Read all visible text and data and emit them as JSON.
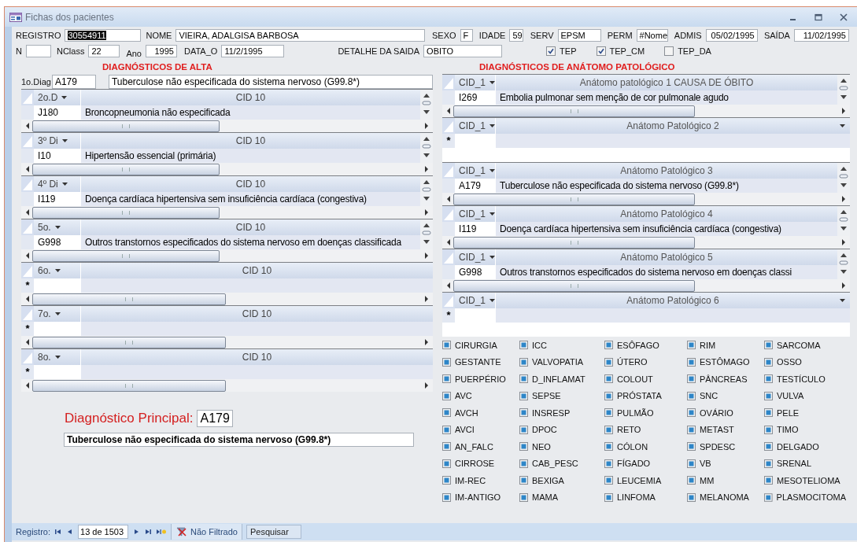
{
  "window": {
    "title": "Fichas dos pacientes"
  },
  "fields_row_1": [
    {
      "label": "REGISTRO",
      "value": "30554911",
      "selected": true
    },
    {
      "label": "NOME",
      "value": "VIEIRA, ADALGISA BARBOSA",
      "selected": false
    },
    {
      "label": "SEXO",
      "value": "F",
      "selected": false
    },
    {
      "label": "IDADE",
      "value": "59",
      "selected": false
    },
    {
      "label": "SERV",
      "value": "EPSM",
      "selected": false
    },
    {
      "label": "PERM",
      "value": "#Nome",
      "selected": false
    },
    {
      "label": "ADMIS",
      "value": "05/02/1995",
      "selected": false
    },
    {
      "label": "SAÍDA",
      "value": "11/02/1995",
      "selected": false
    }
  ],
  "fields_row_2": [
    {
      "label": "N"
    },
    {
      "label": "NClass",
      "value": "22"
    },
    {
      "label": "Ano",
      "value": "1995"
    },
    {
      "label": "DATA_O",
      "value": "11/2/1995"
    },
    {
      "label": "DETALHE DA SAIDA",
      "value": "OBITO"
    }
  ],
  "checkboxes": [
    {
      "label": "TEP",
      "checked": true
    },
    {
      "label": "TEP_CM",
      "checked": true
    },
    {
      "label": "TEP_DA",
      "checked": false
    }
  ],
  "diagnosticos_alta": {
    "title": "DIAGNÓSTICOS DE ALTA",
    "first": {
      "label": "1o.Diag",
      "code": "A179",
      "description": "Tuberculose não especificada do sistema nervoso (G99.8*)"
    },
    "subforms": [
      {
        "column_1": "2o.D",
        "column_2": "CID 10",
        "rows": [
          {
            "code": "J180",
            "description": "Broncopneumonia não especificada"
          }
        ]
      },
      {
        "column_1": "3º Di",
        "column_2": "CID 10",
        "rows": [
          {
            "code": "I10",
            "description": "Hipertensão essencial (primária)"
          }
        ]
      },
      {
        "column_1": "4º Di",
        "column_2": "CID 10",
        "rows": [
          {
            "code": "I119",
            "description": "Doença cardíaca hipertensiva sem insuficiência cardíaca (congestiva)"
          }
        ]
      },
      {
        "column_1": "5o.",
        "column_2": "CID 10",
        "rows": [
          {
            "code": "G998",
            "description": "Outros transtornos especificados do sistema nervoso em doenças classificada"
          }
        ]
      },
      {
        "column_1": "6o.",
        "column_2": "CID 10",
        "new_row": "*"
      },
      {
        "column_1": "7o.",
        "column_2": "CID 10",
        "new_row": "*"
      },
      {
        "column_1": "8o.",
        "column_2": "CID 10",
        "new_row": "*"
      }
    ],
    "principal": {
      "label": "Diagnóstico Principal:",
      "code": "A179",
      "description": "Tuberculose não especificada do sistema nervoso (G99.8*)"
    }
  },
  "anatomo_patologico": {
    "title": "DIAGNÓSTICOS DE ANÁTOMO PATOLÓGICO",
    "subforms": [
      {
        "column_1": "CID_1",
        "column_2": "Anátomo patológico 1 CAUSA DE ÓBITO",
        "rows": [
          {
            "code": "I269",
            "description": "Embolia pulmonar sem menção de cor pulmonale agudo"
          }
        ]
      },
      {
        "column_1": "CID_1",
        "column_2": "Anátomo Patológico 2",
        "new_row": "*"
      },
      {
        "column_1": "CID_1",
        "column_2": "Anátomo Patológico 3",
        "rows": [
          {
            "code": "A179",
            "description": "Tuberculose não especificada do sistema nervoso (G99.8*)"
          }
        ]
      },
      {
        "column_1": "CID_1",
        "column_2": "Anátomo Patológico 4",
        "rows": [
          {
            "code": "I119",
            "description": "Doença cardíaca hipertensiva sem insuficiência cardíaca (congestiva)"
          }
        ]
      },
      {
        "column_1": "CID_1",
        "column_2": "Anátomo Patológico 5",
        "rows": [
          {
            "code": "G998",
            "description": "Outros transtornos especificados do sistema nervoso em doenças classi"
          }
        ]
      },
      {
        "column_1": "CID_1",
        "column_2": "Anátomo Patológico 6",
        "new_row": "*"
      }
    ],
    "flags": [
      {
        "label": "CIRURGIA",
        "indeterminate": true
      },
      {
        "label": "ICC",
        "indeterminate": true
      },
      {
        "label": "ESÔFAGO",
        "indeterminate": true
      },
      {
        "label": "RIM",
        "indeterminate": true
      },
      {
        "label": "SARCOMA",
        "indeterminate": true
      },
      {
        "label": "GESTANTE",
        "indeterminate": true
      },
      {
        "label": "VALVOPATIA",
        "indeterminate": true
      },
      {
        "label": "ÚTERO",
        "indeterminate": true
      },
      {
        "label": "ESTÔMAGO",
        "indeterminate": true
      },
      {
        "label": "OSSO",
        "indeterminate": true
      },
      {
        "label": "PUERPÉRIO",
        "indeterminate": true
      },
      {
        "label": "D_INFLAMAT",
        "indeterminate": true
      },
      {
        "label": "COLOUT",
        "indeterminate": true
      },
      {
        "label": "PÂNCREAS",
        "indeterminate": true
      },
      {
        "label": "TESTÍCULO",
        "indeterminate": true
      },
      {
        "label": "AVC",
        "indeterminate": true
      },
      {
        "label": "SEPSE",
        "indeterminate": true
      },
      {
        "label": "PRÓSTATA",
        "indeterminate": true
      },
      {
        "label": "SNC",
        "indeterminate": true
      },
      {
        "label": "VULVA",
        "indeterminate": true
      },
      {
        "label": "AVCH",
        "indeterminate": true
      },
      {
        "label": "INSRESP",
        "indeterminate": true
      },
      {
        "label": "PULMÃO",
        "indeterminate": true
      },
      {
        "label": "OVÁRIO",
        "indeterminate": true
      },
      {
        "label": "PELE",
        "indeterminate": true
      },
      {
        "label": "AVCI",
        "indeterminate": true
      },
      {
        "label": "DPOC",
        "indeterminate": true
      },
      {
        "label": "RETO",
        "indeterminate": true
      },
      {
        "label": "METAST",
        "indeterminate": true
      },
      {
        "label": "TIMO",
        "indeterminate": true
      },
      {
        "label": "AN_FALC",
        "indeterminate": true
      },
      {
        "label": "NEO",
        "indeterminate": true
      },
      {
        "label": "CÓLON",
        "indeterminate": true
      },
      {
        "label": "SPDESC",
        "indeterminate": true
      },
      {
        "label": "DELGADO",
        "indeterminate": true
      },
      {
        "label": "CIRROSE",
        "indeterminate": true
      },
      {
        "label": "CAB_PESC",
        "indeterminate": true
      },
      {
        "label": "FÍGADO",
        "indeterminate": true
      },
      {
        "label": "VB",
        "indeterminate": true
      },
      {
        "label": "SRENAL",
        "indeterminate": true
      },
      {
        "label": "IM-REC",
        "indeterminate": true
      },
      {
        "label": "BEXIGA",
        "indeterminate": true
      },
      {
        "label": "LEUCEMIA",
        "indeterminate": true
      },
      {
        "label": "MM",
        "indeterminate": true
      },
      {
        "label": "MESOTELIOMA",
        "indeterminate": true
      },
      {
        "label": "IM-ANTIGO",
        "indeterminate": true
      },
      {
        "label": "MAMA",
        "indeterminate": true
      },
      {
        "label": "LINFOMA",
        "indeterminate": true
      },
      {
        "label": "MELANOMA",
        "indeterminate": true
      },
      {
        "label": "PLASMOCITOMA",
        "indeterminate": true
      }
    ]
  },
  "status_bar": {
    "label": "Registro:",
    "position": "13 de 1503",
    "filter": "Não Filtrado",
    "search": "Pesquisar"
  }
}
